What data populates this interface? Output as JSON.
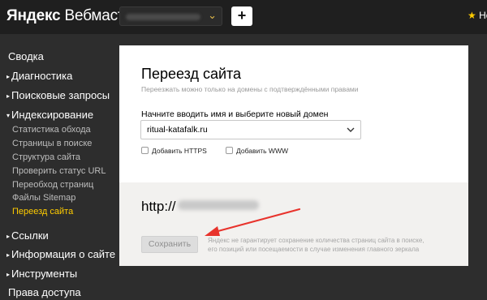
{
  "header": {
    "logo_brand": "Яндекс",
    "logo_product": "Вебмастер",
    "add_label": "+",
    "right_text": "Но",
    "accent": "#ffcc00"
  },
  "sidebar": {
    "items": [
      {
        "label": "Сводка",
        "arrow": ""
      },
      {
        "label": "Диагностика",
        "arrow": "▸"
      },
      {
        "label": "Поисковые запросы",
        "arrow": "▸"
      },
      {
        "label": "Индексирование",
        "arrow": "▾"
      },
      {
        "label": "Ссылки",
        "arrow": "▸"
      },
      {
        "label": "Информация о сайте",
        "arrow": "▸"
      },
      {
        "label": "Инструменты",
        "arrow": "▸"
      },
      {
        "label": "Права доступа",
        "arrow": ""
      }
    ],
    "sub_items": [
      "Статистика обхода",
      "Страницы в поиске",
      "Структура сайта",
      "Проверить статус URL",
      "Переобход страниц",
      "Файлы Sitemap",
      "Переезд сайта"
    ],
    "active_sub": "Переезд сайта"
  },
  "main": {
    "title": "Переезд сайта",
    "subtitle": "Переезжать можно только на домены с подтверждёнными правами",
    "field_label": "Начните вводить имя и выберите новый домен",
    "domain_value": "ritual-katafalk.ru",
    "checkbox_https": "Добавить HTTPS",
    "checkbox_www": "Добавить WWW",
    "url_prefix": "http://",
    "save_label": "Сохранить",
    "warning_line1": "Яндекс не гарантирует сохранение количества страниц сайта в поиске,",
    "warning_line2": "его позиций или посещаемости в случае изменения главного зеркала"
  },
  "annotation": {
    "arrow_color": "#e8332c"
  }
}
